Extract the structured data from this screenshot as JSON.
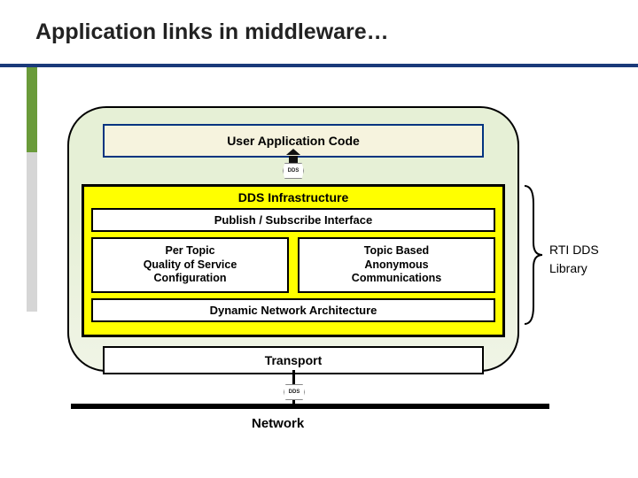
{
  "title": "Application links in middleware…",
  "diagram": {
    "user_app": "User Application Code",
    "dds_badge": "DDS",
    "dds_infrastructure_label": "DDS Infrastructure",
    "pubsub": "Publish / Subscribe Interface",
    "qos": "Per Topic\nQuality of Service\nConfiguration",
    "topic_comm": "Topic Based\nAnonymous\nCommunications",
    "dyn_arch": "Dynamic Network Architecture",
    "transport": "Transport",
    "network": "Network"
  },
  "library": {
    "line1": "RTI DDS",
    "line2": "Library"
  },
  "colors": {
    "accent_navy": "#1a3a7a",
    "highlight_yellow": "#ffff00",
    "container_green": "#e6f0d6"
  }
}
